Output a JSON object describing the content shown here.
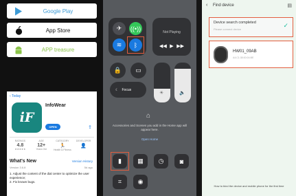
{
  "stores": {
    "google_play": "Google Play",
    "app_store": "App Store",
    "apk": "APP treasure"
  },
  "app": {
    "back": "Today",
    "icon_text": "iF",
    "name": "InfoWear",
    "open": "OPEN",
    "stats": [
      {
        "top": "RATINGS",
        "value": "4.8",
        "bottom": "★★★★★"
      },
      {
        "top": "AGE",
        "value": "12+",
        "bottom": "Years Old"
      },
      {
        "top": "CATEGORY",
        "value": "🏃",
        "bottom": "Health & Fitness"
      },
      {
        "top": "DEVELOPER",
        "value": "👤",
        "bottom": ""
      }
    ],
    "whats_new": "What's New",
    "version_history": "Version History",
    "version": "Version 3.6.8",
    "ago": "5d ago",
    "notes": "1. Adjust the content of the dial center to optimize the user experience;\n2. Fix known bugs."
  },
  "control_center": {
    "now_playing": "Not Playing",
    "focus": "Focus",
    "brightness": 0.35,
    "volume": 0.85,
    "home_desc": "Accessories and Scenes you add in the Home app will appear here.",
    "open_home": "Open Home"
  },
  "find": {
    "title": "Find device",
    "complete": "Device search completed",
    "complete_sub": "Please connect device",
    "device_name": "HW01_09AB",
    "device_mac": "A4:C1:38:00:0A:BE",
    "help": "How to bind the device and mobile phone for the first time"
  },
  "colors": {
    "accent": "#e35d3e",
    "teal": "#19867f",
    "blue": "#1a7ae0"
  }
}
